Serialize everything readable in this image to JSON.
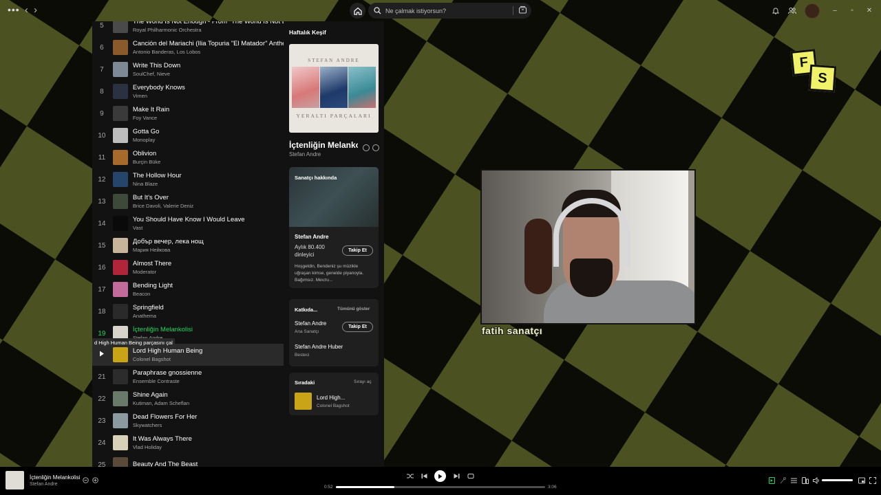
{
  "colors": {
    "accent": "#1ed760",
    "checker_light": "#4b5120",
    "checker_dark": "#0b0c06",
    "caption": "#f1f5c2"
  },
  "topbar": {
    "menu_icon": "more-dots-icon",
    "search_placeholder": "Ne çalmak istiyorsun?"
  },
  "tracks": [
    {
      "num": "5",
      "title": "The World Is Not Enough - From \"The World Is Not Enough\"",
      "artist": "Royal Philharmonic Orchestra",
      "thumb": "#4a4a4a"
    },
    {
      "num": "6",
      "title": "Canción del Mariachi (Ilia Topuria \"El Matador\" Anthem)",
      "artist": "Antonio Banderas, Los Lobos",
      "thumb": "#8a5a2a"
    },
    {
      "num": "7",
      "title": "Write This Down",
      "artist": "SoulChef, Nieve",
      "thumb": "#7d8a96"
    },
    {
      "num": "8",
      "title": "Everybody Knows",
      "artist": "Vimen",
      "thumb": "#2a3140"
    },
    {
      "num": "9",
      "title": "Make It Rain",
      "artist": "Foy Vance",
      "thumb": "#3a3a3a"
    },
    {
      "num": "10",
      "title": "Gotta Go",
      "artist": "Monoplay",
      "thumb": "#bdbdbd"
    },
    {
      "num": "11",
      "title": "Oblivion",
      "artist": "Burçin Büke",
      "thumb": "#a86a2a"
    },
    {
      "num": "12",
      "title": "The Hollow Hour",
      "artist": "Nina Blaze",
      "thumb": "#26456a"
    },
    {
      "num": "13",
      "title": "But It's Over",
      "artist": "Brice Davoli, Valerie Deniz",
      "thumb": "#3d4a3a"
    },
    {
      "num": "14",
      "title": "You Should Have Know I Would Leave",
      "artist": "Vast",
      "thumb": "#0a0a0a"
    },
    {
      "num": "15",
      "title": "Добър вечер, лека нощ",
      "artist": "Мария Нейкова",
      "thumb": "#c7b49a"
    },
    {
      "num": "16",
      "title": "Almost There",
      "artist": "Moderator",
      "thumb": "#b0253a"
    },
    {
      "num": "17",
      "title": "Bending Light",
      "artist": "Beacon",
      "thumb": "#c26a9a"
    },
    {
      "num": "18",
      "title": "Springfield",
      "artist": "Anathema",
      "thumb": "#2a2a2a"
    },
    {
      "num": "19",
      "title": "İçtenliğin Melankolisi",
      "artist": "Stefan Andre",
      "thumb": "#d8d4cc"
    },
    {
      "num": "",
      "title": "Lord High Human Being",
      "artist": "Colonel Bagshot",
      "thumb": "#c9a417"
    },
    {
      "num": "21",
      "title": "Paraphrase gnossienne",
      "artist": "Ensemble Contraste",
      "thumb": "#2c2c2c"
    },
    {
      "num": "22",
      "title": "Shine Again",
      "artist": "Kutiman, Adam Scheflan",
      "thumb": "#6a7a6a"
    },
    {
      "num": "23",
      "title": "Dead Flowers For Her",
      "artist": "Skywatchers",
      "thumb": "#8a9aa0"
    },
    {
      "num": "24",
      "title": "It Was Always There",
      "artist": "Vlad Holiday",
      "thumb": "#d8d0b8"
    },
    {
      "num": "25",
      "title": "Beauty And The Beast",
      "artist": "",
      "thumb": "#5a4a3a"
    }
  ],
  "tooltip": "d High Human Being parçasını çal",
  "right_panel": {
    "heading": "Haftalık Keşif",
    "cover_artist": "STEFAN ANDRE",
    "cover_album": "YERALTI PARÇALARI",
    "track_title": "İçtenliğin Melankolisi",
    "track_artist": "Stefan Andre",
    "about_label": "Sanatçı hakkında",
    "artist_name": "Stefan Andre",
    "listeners": "Aylık 80.400 dinleyici",
    "follow_label": "Takip Et",
    "bio": "Hoşgeldin, Bendeniz şu müzikle uğraşan kimse, genelde piyanoyla. Bağımsız. Mevzu...",
    "credits_label": "Katkıda...",
    "show_all": "Tümünü göster",
    "credit1_name": "Stefan Andre",
    "credit1_role": "Ana Sanatçı",
    "credit2_name": "Stefan Andre Huber",
    "credit2_role": "Besteci",
    "next_label": "Sıradaki",
    "open_queue": "Sırayı aç",
    "next_title": "Lord High...",
    "next_artist": "Colonel Bagshot"
  },
  "player": {
    "title": "İçtenliğin Melankolisi",
    "artist": "Stefan Andre",
    "elapsed": "0:52",
    "duration": "3:06",
    "progress": 0.28,
    "volume": 0.95
  },
  "overlay": {
    "caption": "fatih sanatçı",
    "logo_top": "F",
    "logo_bottom": "S"
  }
}
